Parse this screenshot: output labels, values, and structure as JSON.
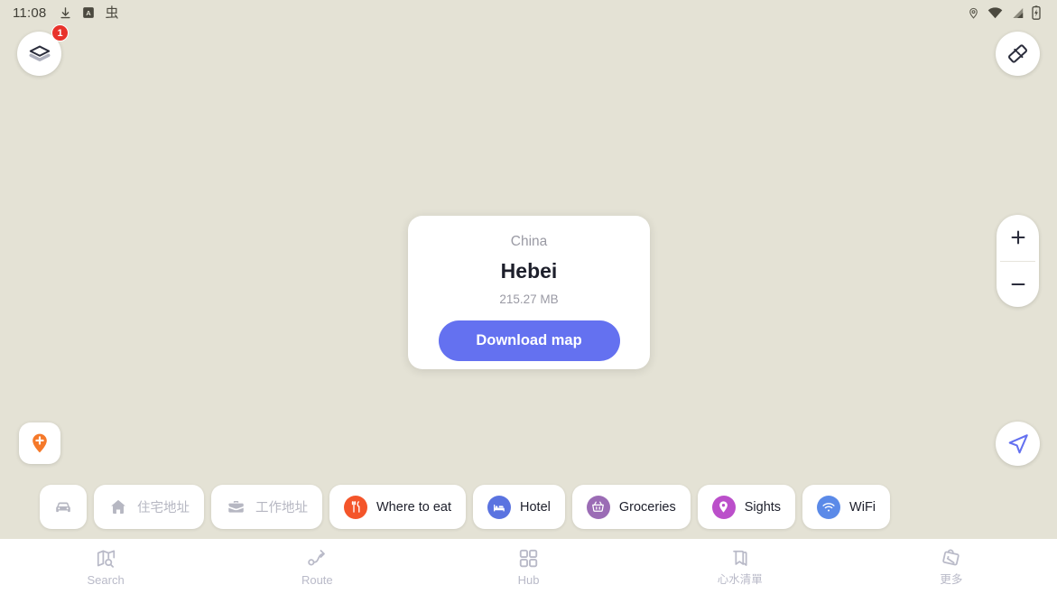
{
  "status_bar": {
    "clock": "11:08",
    "left_icons": [
      "download-icon",
      "translate-app-icon",
      "bug-glyph-icon"
    ],
    "bug_glyph": "虫",
    "right_icons": [
      "location-pin-icon",
      "wifi-icon",
      "cellular-signal-icon",
      "battery-charging-icon"
    ]
  },
  "map": {
    "background_color": "#e4e2d5",
    "layers_button": {
      "icon": "layers-icon",
      "badge": "1",
      "badge_color": "#e8322b"
    },
    "ruler_button": {
      "icon": "ruler-icon"
    },
    "zoom_in_button": {
      "label": "+"
    },
    "zoom_out_button": {
      "label": "−"
    },
    "add_place_button": {
      "icon": "pin-plus-icon",
      "color": "#f5792a"
    },
    "locate_button": {
      "icon": "navigation-arrow-icon",
      "color": "#6471f0"
    }
  },
  "download_card": {
    "country": "China",
    "region": "Hebei",
    "size": "215.27 MB",
    "button_label": "Download map",
    "button_color": "#6471f0"
  },
  "chips": [
    {
      "name": "car",
      "label": "",
      "icon": "car-icon",
      "icon_color": "#b6b7c2",
      "style": "icon-only"
    },
    {
      "name": "home",
      "label": "住宅地址",
      "icon": "home-icon",
      "icon_color": "#b6b7c2",
      "style": "plain-muted"
    },
    {
      "name": "work",
      "label": "工作地址",
      "icon": "briefcase-icon",
      "icon_color": "#b6b7c2",
      "style": "plain-muted"
    },
    {
      "name": "where-to-eat",
      "label": "Where to eat",
      "icon": "cutlery-icon",
      "icon_color": "#f4552a",
      "style": "dot"
    },
    {
      "name": "hotel",
      "label": "Hotel",
      "icon": "bed-icon",
      "icon_color": "#5a73e0",
      "style": "dot"
    },
    {
      "name": "groceries",
      "label": "Groceries",
      "icon": "basket-icon",
      "icon_color": "#9b6cb5",
      "style": "dot"
    },
    {
      "name": "sights",
      "label": "Sights",
      "icon": "map-pin-icon",
      "icon_color": "#bb4fca",
      "style": "dot"
    },
    {
      "name": "wifi",
      "label": "WiFi",
      "icon": "wifi-icon",
      "icon_color": "#5b8ae8",
      "style": "dot"
    }
  ],
  "bottom_nav": [
    {
      "name": "search",
      "label": "Search",
      "icon": "map-search-icon"
    },
    {
      "name": "route",
      "label": "Route",
      "icon": "route-icon"
    },
    {
      "name": "hub",
      "label": "Hub",
      "icon": "grid-icon"
    },
    {
      "name": "bookmarks",
      "label": "心水清單",
      "icon": "bookmark-icon"
    },
    {
      "name": "more",
      "label": "更多",
      "icon": "more-bag-icon"
    }
  ]
}
